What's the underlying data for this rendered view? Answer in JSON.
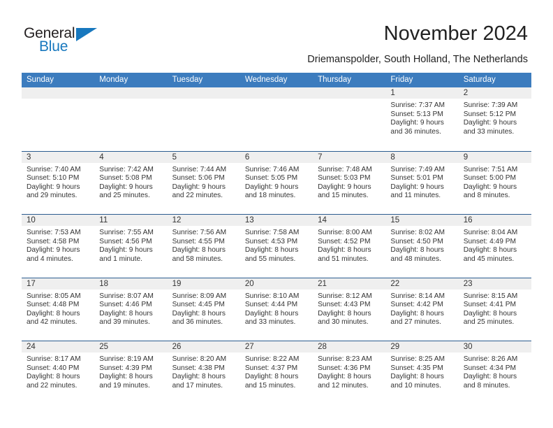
{
  "brand": {
    "name_top": "General",
    "name_bottom": "Blue",
    "colors": {
      "blue": "#1878be",
      "dark": "#231f20"
    }
  },
  "header": {
    "title": "November 2024",
    "subtitle": "Driemanspolder, South Holland, The Netherlands"
  },
  "theme": {
    "header_blue": "#3c7cbe",
    "row_divider": "#2b5c8f",
    "day_band": "#efefef"
  },
  "weekday_headers": [
    "Sunday",
    "Monday",
    "Tuesday",
    "Wednesday",
    "Thursday",
    "Friday",
    "Saturday"
  ],
  "weeks": [
    {
      "days": [
        {
          "empty": true
        },
        {
          "empty": true
        },
        {
          "empty": true
        },
        {
          "empty": true
        },
        {
          "empty": true
        },
        {
          "empty": false,
          "date": "1",
          "sunrise": "Sunrise: 7:37 AM",
          "sunset": "Sunset: 5:13 PM",
          "daylight_line1": "Daylight: 9 hours",
          "daylight_line2": "and 36 minutes."
        },
        {
          "empty": false,
          "date": "2",
          "sunrise": "Sunrise: 7:39 AM",
          "sunset": "Sunset: 5:12 PM",
          "daylight_line1": "Daylight: 9 hours",
          "daylight_line2": "and 33 minutes."
        }
      ]
    },
    {
      "days": [
        {
          "empty": false,
          "date": "3",
          "sunrise": "Sunrise: 7:40 AM",
          "sunset": "Sunset: 5:10 PM",
          "daylight_line1": "Daylight: 9 hours",
          "daylight_line2": "and 29 minutes."
        },
        {
          "empty": false,
          "date": "4",
          "sunrise": "Sunrise: 7:42 AM",
          "sunset": "Sunset: 5:08 PM",
          "daylight_line1": "Daylight: 9 hours",
          "daylight_line2": "and 25 minutes."
        },
        {
          "empty": false,
          "date": "5",
          "sunrise": "Sunrise: 7:44 AM",
          "sunset": "Sunset: 5:06 PM",
          "daylight_line1": "Daylight: 9 hours",
          "daylight_line2": "and 22 minutes."
        },
        {
          "empty": false,
          "date": "6",
          "sunrise": "Sunrise: 7:46 AM",
          "sunset": "Sunset: 5:05 PM",
          "daylight_line1": "Daylight: 9 hours",
          "daylight_line2": "and 18 minutes."
        },
        {
          "empty": false,
          "date": "7",
          "sunrise": "Sunrise: 7:48 AM",
          "sunset": "Sunset: 5:03 PM",
          "daylight_line1": "Daylight: 9 hours",
          "daylight_line2": "and 15 minutes."
        },
        {
          "empty": false,
          "date": "8",
          "sunrise": "Sunrise: 7:49 AM",
          "sunset": "Sunset: 5:01 PM",
          "daylight_line1": "Daylight: 9 hours",
          "daylight_line2": "and 11 minutes."
        },
        {
          "empty": false,
          "date": "9",
          "sunrise": "Sunrise: 7:51 AM",
          "sunset": "Sunset: 5:00 PM",
          "daylight_line1": "Daylight: 9 hours",
          "daylight_line2": "and 8 minutes."
        }
      ]
    },
    {
      "days": [
        {
          "empty": false,
          "date": "10",
          "sunrise": "Sunrise: 7:53 AM",
          "sunset": "Sunset: 4:58 PM",
          "daylight_line1": "Daylight: 9 hours",
          "daylight_line2": "and 4 minutes."
        },
        {
          "empty": false,
          "date": "11",
          "sunrise": "Sunrise: 7:55 AM",
          "sunset": "Sunset: 4:56 PM",
          "daylight_line1": "Daylight: 9 hours",
          "daylight_line2": "and 1 minute."
        },
        {
          "empty": false,
          "date": "12",
          "sunrise": "Sunrise: 7:56 AM",
          "sunset": "Sunset: 4:55 PM",
          "daylight_line1": "Daylight: 8 hours",
          "daylight_line2": "and 58 minutes."
        },
        {
          "empty": false,
          "date": "13",
          "sunrise": "Sunrise: 7:58 AM",
          "sunset": "Sunset: 4:53 PM",
          "daylight_line1": "Daylight: 8 hours",
          "daylight_line2": "and 55 minutes."
        },
        {
          "empty": false,
          "date": "14",
          "sunrise": "Sunrise: 8:00 AM",
          "sunset": "Sunset: 4:52 PM",
          "daylight_line1": "Daylight: 8 hours",
          "daylight_line2": "and 51 minutes."
        },
        {
          "empty": false,
          "date": "15",
          "sunrise": "Sunrise: 8:02 AM",
          "sunset": "Sunset: 4:50 PM",
          "daylight_line1": "Daylight: 8 hours",
          "daylight_line2": "and 48 minutes."
        },
        {
          "empty": false,
          "date": "16",
          "sunrise": "Sunrise: 8:04 AM",
          "sunset": "Sunset: 4:49 PM",
          "daylight_line1": "Daylight: 8 hours",
          "daylight_line2": "and 45 minutes."
        }
      ]
    },
    {
      "days": [
        {
          "empty": false,
          "date": "17",
          "sunrise": "Sunrise: 8:05 AM",
          "sunset": "Sunset: 4:48 PM",
          "daylight_line1": "Daylight: 8 hours",
          "daylight_line2": "and 42 minutes."
        },
        {
          "empty": false,
          "date": "18",
          "sunrise": "Sunrise: 8:07 AM",
          "sunset": "Sunset: 4:46 PM",
          "daylight_line1": "Daylight: 8 hours",
          "daylight_line2": "and 39 minutes."
        },
        {
          "empty": false,
          "date": "19",
          "sunrise": "Sunrise: 8:09 AM",
          "sunset": "Sunset: 4:45 PM",
          "daylight_line1": "Daylight: 8 hours",
          "daylight_line2": "and 36 minutes."
        },
        {
          "empty": false,
          "date": "20",
          "sunrise": "Sunrise: 8:10 AM",
          "sunset": "Sunset: 4:44 PM",
          "daylight_line1": "Daylight: 8 hours",
          "daylight_line2": "and 33 minutes."
        },
        {
          "empty": false,
          "date": "21",
          "sunrise": "Sunrise: 8:12 AM",
          "sunset": "Sunset: 4:43 PM",
          "daylight_line1": "Daylight: 8 hours",
          "daylight_line2": "and 30 minutes."
        },
        {
          "empty": false,
          "date": "22",
          "sunrise": "Sunrise: 8:14 AM",
          "sunset": "Sunset: 4:42 PM",
          "daylight_line1": "Daylight: 8 hours",
          "daylight_line2": "and 27 minutes."
        },
        {
          "empty": false,
          "date": "23",
          "sunrise": "Sunrise: 8:15 AM",
          "sunset": "Sunset: 4:41 PM",
          "daylight_line1": "Daylight: 8 hours",
          "daylight_line2": "and 25 minutes."
        }
      ]
    },
    {
      "days": [
        {
          "empty": false,
          "date": "24",
          "sunrise": "Sunrise: 8:17 AM",
          "sunset": "Sunset: 4:40 PM",
          "daylight_line1": "Daylight: 8 hours",
          "daylight_line2": "and 22 minutes."
        },
        {
          "empty": false,
          "date": "25",
          "sunrise": "Sunrise: 8:19 AM",
          "sunset": "Sunset: 4:39 PM",
          "daylight_line1": "Daylight: 8 hours",
          "daylight_line2": "and 19 minutes."
        },
        {
          "empty": false,
          "date": "26",
          "sunrise": "Sunrise: 8:20 AM",
          "sunset": "Sunset: 4:38 PM",
          "daylight_line1": "Daylight: 8 hours",
          "daylight_line2": "and 17 minutes."
        },
        {
          "empty": false,
          "date": "27",
          "sunrise": "Sunrise: 8:22 AM",
          "sunset": "Sunset: 4:37 PM",
          "daylight_line1": "Daylight: 8 hours",
          "daylight_line2": "and 15 minutes."
        },
        {
          "empty": false,
          "date": "28",
          "sunrise": "Sunrise: 8:23 AM",
          "sunset": "Sunset: 4:36 PM",
          "daylight_line1": "Daylight: 8 hours",
          "daylight_line2": "and 12 minutes."
        },
        {
          "empty": false,
          "date": "29",
          "sunrise": "Sunrise: 8:25 AM",
          "sunset": "Sunset: 4:35 PM",
          "daylight_line1": "Daylight: 8 hours",
          "daylight_line2": "and 10 minutes."
        },
        {
          "empty": false,
          "date": "30",
          "sunrise": "Sunrise: 8:26 AM",
          "sunset": "Sunset: 4:34 PM",
          "daylight_line1": "Daylight: 8 hours",
          "daylight_line2": "and 8 minutes."
        }
      ]
    }
  ]
}
